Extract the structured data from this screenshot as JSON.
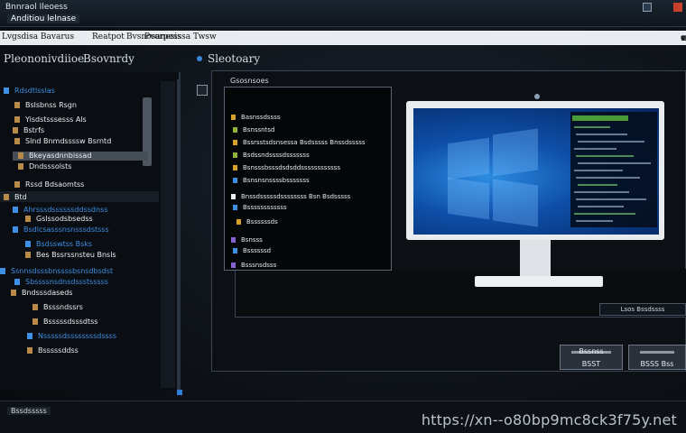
{
  "window": {
    "title_line1": "Bnnraol Ileoess",
    "title_line2": "Anditiou lelnase"
  },
  "menu": {
    "items": [
      "Lvgsdisa Bavarus",
      "Reatpot",
      "Bvsnosanesis",
      "Pvorpesssa Twsw"
    ],
    "right_icons": [
      "▾",
      "⌁",
      "◂",
      "⟳",
      "⊞",
      "⊕"
    ]
  },
  "left_pane": {
    "heading": "Pleononivdiioe",
    "heading2": "Bsovnrdy",
    "items": [
      {
        "label": "Rdsdtlsslas",
        "color": "#3e8fe6",
        "icon": "folder-icon"
      },
      {
        "label": "Bslsbnss Rsgn",
        "color": "#e8edf2",
        "icon": "file-icon"
      },
      {
        "label": "Yisdstsssesss Als",
        "color": "#e8edf2",
        "icon": "file-icon"
      },
      {
        "label": "Bstrfs",
        "color": "#e8edf2",
        "icon": "file-icon"
      },
      {
        "label": "Slnd Bnmdssssw Bsrntd",
        "color": "#e8edf2",
        "icon": "file-icon"
      },
      {
        "label": "Bkeyasdnnbissad",
        "color": "#e8edf2",
        "icon": "file-icon"
      },
      {
        "label": "Dndsssolsts",
        "color": "#e8edf2",
        "icon": "file-icon"
      },
      {
        "label": "Rssd Bdsaomtss",
        "color": "#e8edf2",
        "icon": "file-icon"
      },
      {
        "label": "Btd",
        "color": "#e8edf2",
        "icon": "file-icon"
      },
      {
        "label": "Ahrsssdssssssddssdnss",
        "color": "#3e8fe6",
        "icon": "folder-icon"
      },
      {
        "label": "Gslssodsbsedss",
        "color": "#e8edf2",
        "icon": "file-icon"
      },
      {
        "label": "Bsdlcsasssnsnsssdstsss",
        "color": "#3e8fe6",
        "icon": "folder-icon"
      },
      {
        "label": "Bsdsswtss Bsks",
        "color": "#3e8fe6",
        "icon": "folder-icon"
      },
      {
        "label": "Bes Bssrssnsteu Bnsls",
        "color": "#e8edf2",
        "icon": "file-icon"
      },
      {
        "label": "Ssnnsdsssbnssssbsnsdbsdst",
        "color": "#3e8fe6",
        "icon": "folder-icon"
      },
      {
        "label": "Sbssssnsdnsdssstsssss",
        "color": "#3e8fe6",
        "icon": "folder-icon"
      },
      {
        "label": "Bndsssdaseds",
        "color": "#e8edf2",
        "icon": "file-icon"
      },
      {
        "label": "Bsssndssrs",
        "color": "#e8edf2",
        "icon": "file-icon"
      },
      {
        "label": "Bsssssdsssdtss",
        "color": "#e8edf2",
        "icon": "file-icon"
      },
      {
        "label": "Nsssssdssssssssdssss",
        "color": "#3e8fe6",
        "icon": "folder-icon"
      },
      {
        "label": "Bsssssddss",
        "color": "#e8edf2",
        "icon": "file-icon"
      }
    ]
  },
  "right_pane": {
    "heading": "Sleotoary",
    "list_title": "Gsosnsoes",
    "list": [
      {
        "label": "Basnssdssss",
        "color": "#d6a22a"
      },
      {
        "label": "Bsnssntsd",
        "color": "#8fb43c"
      },
      {
        "label": "Bssrsstsdsnsessa Bsdsssss Bnssdsssss",
        "color": "#d6a22a"
      },
      {
        "label": "Bsdssndssssdsssssss",
        "color": "#8fb43c"
      },
      {
        "label": "Bsnsssbsssdsdsddssssssssssss",
        "color": "#d6a22a"
      },
      {
        "label": "Bsnsnsnssssbsssssss",
        "color": "#3e8fe6"
      },
      {
        "label": "Bnssdsssssdssssssss Bsn Bsdsssss",
        "color": "#e8edf2"
      },
      {
        "label": "Bssssssssssss",
        "color": "#3e8fe6"
      },
      {
        "label": "Bssssssds",
        "color": "#d6a22a"
      },
      {
        "label": "Bsnsss",
        "color": "#8a60d6"
      },
      {
        "label": "Bssssssd",
        "color": "#3e8fe6"
      },
      {
        "label": "Bsssnsdsss",
        "color": "#8a60d6"
      }
    ],
    "lower_label": "Lsos Bssdssss",
    "button1": "Bssnss",
    "button1_sub": "BSST",
    "button2": "BSSS Bss"
  },
  "status": {
    "text": "Bssdsssss"
  },
  "watermark": "https://xn--o80bp9mc8ck3f75y.net",
  "colors": {
    "accent": "#3e8fe6",
    "background": "#0b0e12",
    "close": "#c8412f"
  }
}
